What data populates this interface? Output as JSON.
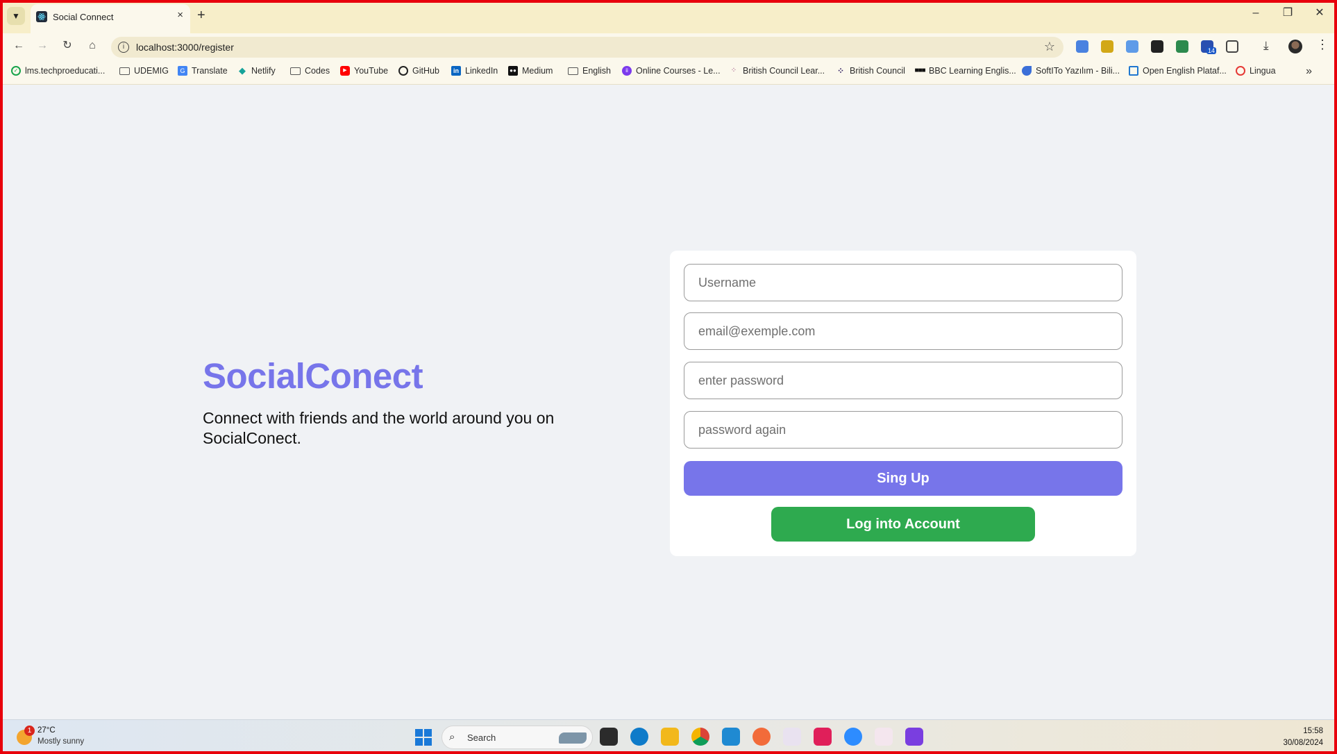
{
  "browser": {
    "tab_title": "Social Connect",
    "url": "localhost:3000/register",
    "new_tab_symbol": "+",
    "close_tab_symbol": "×"
  },
  "bookmarks": [
    {
      "label": "lms.techproeducati...",
      "icon": "check-circle-icon",
      "color": "#17a34a"
    },
    {
      "label": "UDEMIG",
      "icon": "folder-icon",
      "color": "#555555"
    },
    {
      "label": "Translate",
      "icon": "translate-icon",
      "color": "#4285f4"
    },
    {
      "label": "Netlify",
      "icon": "netlify-icon",
      "color": "#16a39a"
    },
    {
      "label": "Codes",
      "icon": "folder-icon",
      "color": "#555555"
    },
    {
      "label": "YouTube",
      "icon": "youtube-icon",
      "color": "#ff0000"
    },
    {
      "label": "GitHub",
      "icon": "github-icon",
      "color": "#222222"
    },
    {
      "label": "LinkedIn",
      "icon": "linkedin-icon",
      "color": "#0a66c2"
    },
    {
      "label": "Medium",
      "icon": "medium-icon",
      "color": "#111111"
    },
    {
      "label": "English",
      "icon": "folder-icon",
      "color": "#555555"
    },
    {
      "label": "Online Courses - Le...",
      "icon": "courses-icon",
      "color": "#7c3aed"
    },
    {
      "label": "British Council Lear...",
      "icon": "british-council-icon",
      "color": "#8b2c6b"
    },
    {
      "label": "British Council",
      "icon": "british-council-icon",
      "color": "#2b1a5e"
    },
    {
      "label": "BBC Learning Englis...",
      "icon": "bbc-icon",
      "color": "#111111"
    },
    {
      "label": "SoftITo Yazılım - Bili...",
      "icon": "softito-icon",
      "color": "#3b6fd8"
    },
    {
      "label": "Open English Plataf...",
      "icon": "open-english-icon",
      "color": "#1f77d0"
    },
    {
      "label": "Lingua",
      "icon": "lingua-icon",
      "color": "#e53935"
    }
  ],
  "page": {
    "brand": "SocialConect",
    "tagline": "Connect with friends and the world around you on SocialConect.",
    "form": {
      "username_placeholder": "Username",
      "email_placeholder": "email@exemple.com",
      "password_placeholder": "enter password",
      "password_again_placeholder": "password again",
      "signup_label": "Sing Up",
      "login_label": "Log into Account"
    }
  },
  "colors": {
    "accent": "#7775ea",
    "login_green": "#2eaa4f",
    "background": "#f0f2f5",
    "frame": "#e8000b"
  },
  "taskbar": {
    "weather_badge": "1",
    "temperature": "27°C",
    "weather_desc": "Mostly sunny",
    "search_label": "Search",
    "time": "15:58",
    "date": "30/08/2024",
    "extension_badge": "14"
  }
}
